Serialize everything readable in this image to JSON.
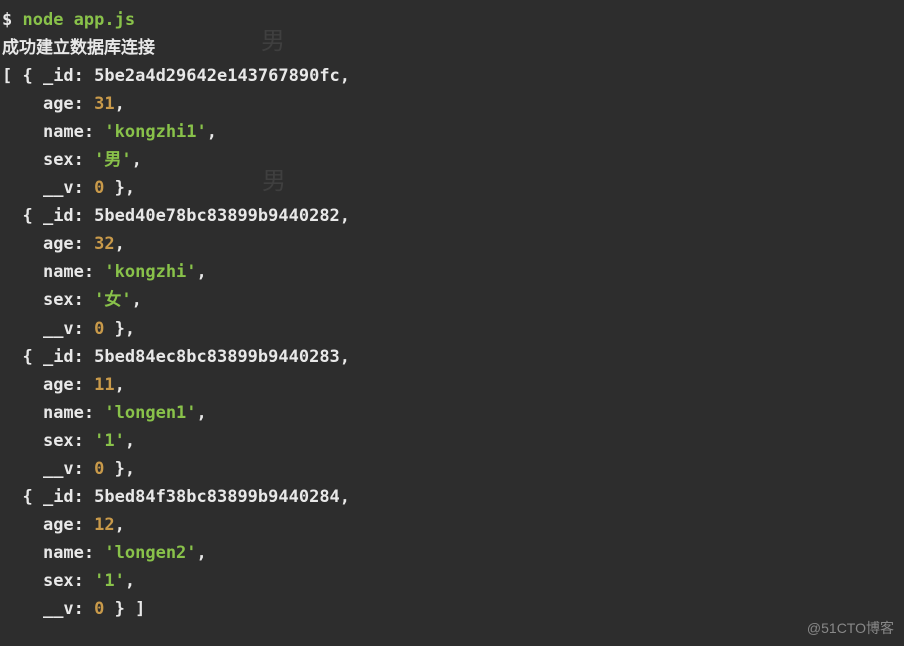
{
  "prompt_symbol": "$",
  "command": "node app.js",
  "connection_msg": "成功建立数据库连接",
  "ghost1": "男",
  "ghost2": "男",
  "records": [
    {
      "_id": "5be2a4d29642e143767890fc",
      "age": 31,
      "name": "kongzhi1",
      "sex": "男",
      "__v": 0
    },
    {
      "_id": "5bed40e78bc83899b9440282",
      "age": 32,
      "name": "kongzhi",
      "sex": "女",
      "__v": 0
    },
    {
      "_id": "5bed84ec8bc83899b9440283",
      "age": 11,
      "name": "longen1",
      "sex": "1",
      "__v": 0
    },
    {
      "_id": "5bed84f38bc83899b9440284",
      "age": 12,
      "name": "longen2",
      "sex": "1",
      "__v": 0
    }
  ],
  "labels": {
    "id": "_id",
    "age": "age",
    "name": "name",
    "sex": "sex",
    "v": "__v"
  },
  "watermark": "@51CTO博客"
}
